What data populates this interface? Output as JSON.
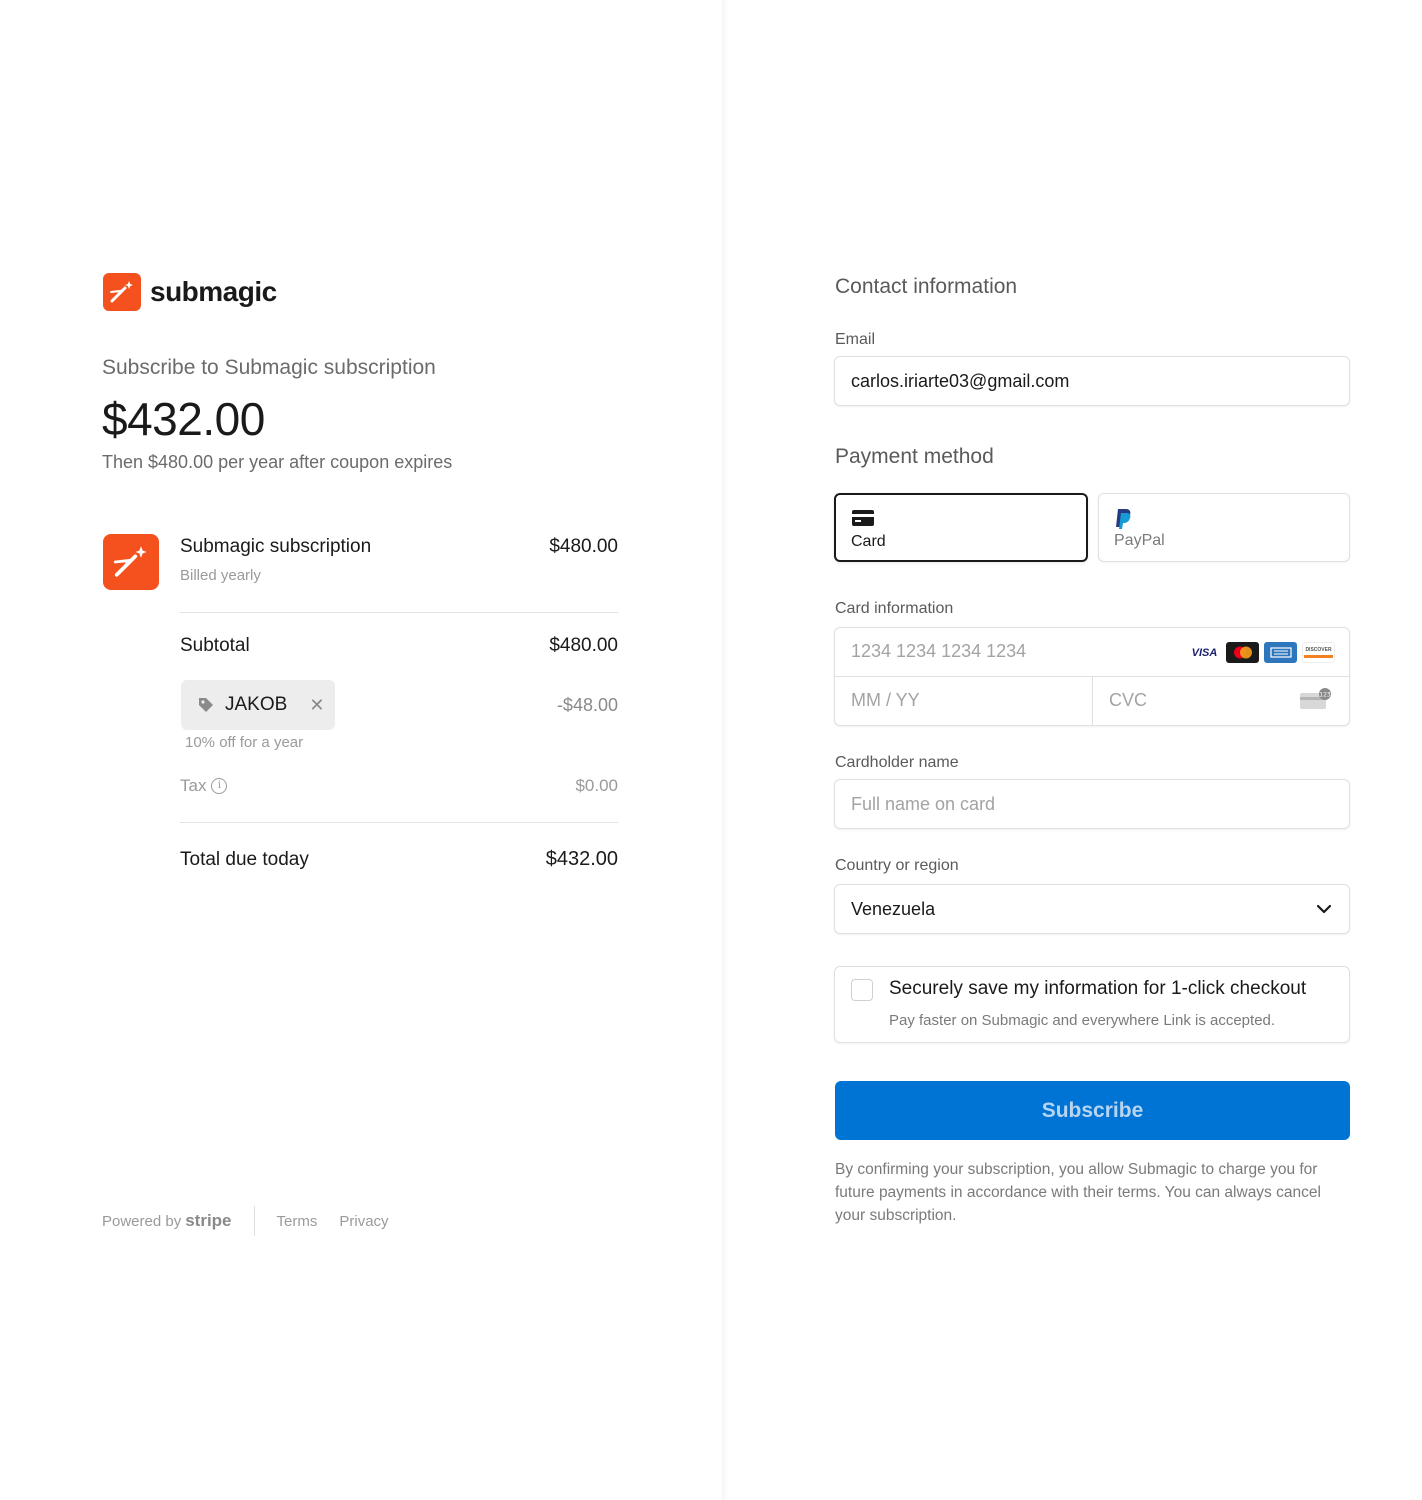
{
  "brand": {
    "name": "submagic",
    "accent": "#f4511e",
    "logo_icon": "magic-wand-icon"
  },
  "summary": {
    "subscribe_label": "Subscribe to Submagic subscription",
    "amount": "$432.00",
    "then_text": "Then $480.00 per year after coupon expires"
  },
  "line_item": {
    "name": "Submagic subscription",
    "billing": "Billed yearly",
    "price": "$480.00"
  },
  "totals": {
    "subtotal_label": "Subtotal",
    "subtotal_value": "$480.00",
    "coupon_code": "JAKOB",
    "coupon_remove": "✕",
    "discount_value": "-$48.00",
    "coupon_description": "10% off for a year",
    "tax_label": "Tax",
    "tax_info": "i",
    "tax_value": "$0.00",
    "total_label": "Total due today",
    "total_value": "$432.00"
  },
  "footer": {
    "powered_by": "Powered by",
    "stripe": "stripe",
    "terms": "Terms",
    "privacy": "Privacy"
  },
  "contact": {
    "title": "Contact information",
    "email_label": "Email",
    "email_value": "carlos.iriarte03@gmail.com"
  },
  "payment": {
    "title": "Payment method",
    "methods": [
      {
        "label": "Card",
        "icon": "credit-card-icon",
        "selected": true
      },
      {
        "label": "PayPal",
        "icon": "paypal-icon",
        "selected": false
      }
    ]
  },
  "card": {
    "label": "Card information",
    "number_placeholder": "1234 1234 1234 1234",
    "expiry_placeholder": "MM / YY",
    "cvc_placeholder": "CVC",
    "brands": [
      "visa-logo",
      "mastercard-logo",
      "amex-logo",
      "discover-logo"
    ],
    "visa_text": "VISA",
    "discover_text": "DISCOVER"
  },
  "cardholder": {
    "label": "Cardholder name",
    "placeholder": "Full name on card"
  },
  "country": {
    "label": "Country or region",
    "value": "Venezuela"
  },
  "save_info": {
    "title": "Securely save my information for 1-click checkout",
    "subtitle": "Pay faster on Submagic and everywhere Link is accepted.",
    "checked": false
  },
  "subscribe_button": {
    "label": "Subscribe",
    "color": "#0074d4"
  },
  "legal": "By confirming your subscription, you allow Submagic to charge you for future payments in accordance with their terms. You can always cancel your subscription."
}
